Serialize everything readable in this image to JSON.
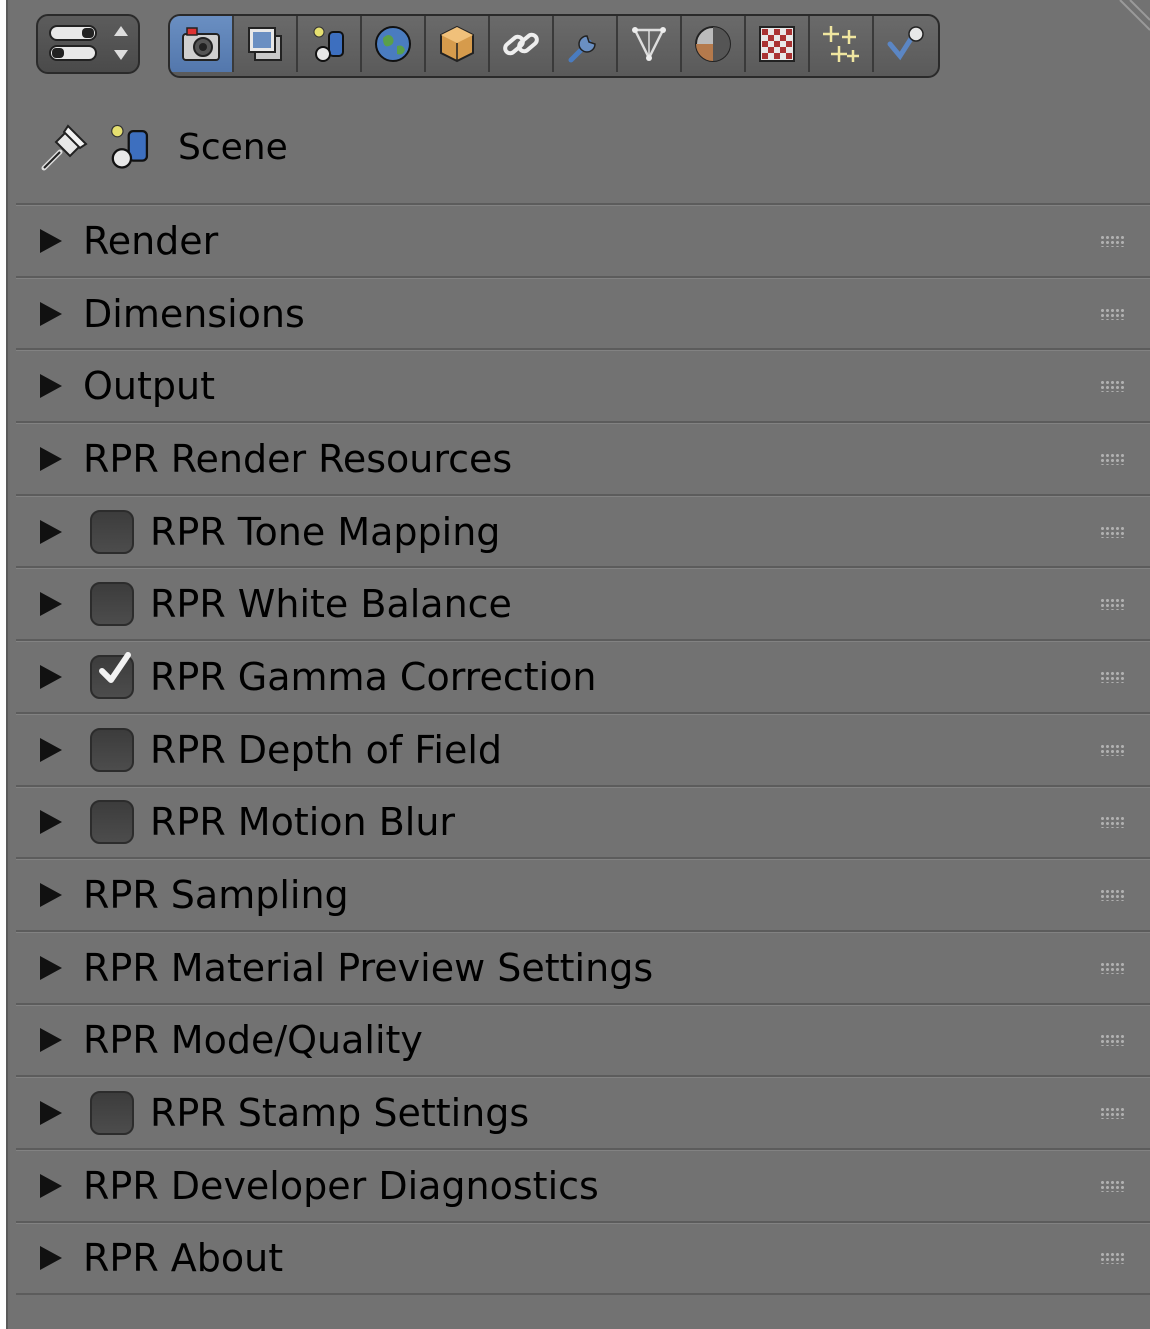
{
  "header": {
    "editor_type_icon": "properties-editor-icon",
    "tabs": [
      {
        "icon": "render-camera-icon",
        "active": true
      },
      {
        "icon": "render-layers-icon",
        "active": false
      },
      {
        "icon": "scene-icon",
        "active": false
      },
      {
        "icon": "world-icon",
        "active": false
      },
      {
        "icon": "object-icon",
        "active": false
      },
      {
        "icon": "constraints-icon",
        "active": false
      },
      {
        "icon": "modifiers-icon",
        "active": false
      },
      {
        "icon": "mesh-data-icon",
        "active": false
      },
      {
        "icon": "material-icon",
        "active": false
      },
      {
        "icon": "texture-icon",
        "active": false
      },
      {
        "icon": "particles-icon",
        "active": false
      },
      {
        "icon": "physics-icon",
        "active": false
      }
    ]
  },
  "context": {
    "pin_icon": "pin-icon",
    "scene_icon": "scene-icon",
    "label": "Scene"
  },
  "panels": [
    {
      "label": "Render",
      "has_checkbox": false,
      "checked": false
    },
    {
      "label": "Dimensions",
      "has_checkbox": false,
      "checked": false
    },
    {
      "label": "Output",
      "has_checkbox": false,
      "checked": false
    },
    {
      "label": "RPR Render Resources",
      "has_checkbox": false,
      "checked": false
    },
    {
      "label": "RPR Tone Mapping",
      "has_checkbox": true,
      "checked": false
    },
    {
      "label": "RPR White Balance",
      "has_checkbox": true,
      "checked": false
    },
    {
      "label": "RPR Gamma Correction",
      "has_checkbox": true,
      "checked": true
    },
    {
      "label": "RPR Depth of Field",
      "has_checkbox": true,
      "checked": false
    },
    {
      "label": "RPR Motion Blur",
      "has_checkbox": true,
      "checked": false
    },
    {
      "label": "RPR Sampling",
      "has_checkbox": false,
      "checked": false
    },
    {
      "label": "RPR Material Preview Settings",
      "has_checkbox": false,
      "checked": false
    },
    {
      "label": "RPR Mode/Quality",
      "has_checkbox": false,
      "checked": false
    },
    {
      "label": "RPR Stamp Settings",
      "has_checkbox": true,
      "checked": false
    },
    {
      "label": "RPR Developer Diagnostics",
      "has_checkbox": false,
      "checked": false
    },
    {
      "label": "RPR About",
      "has_checkbox": false,
      "checked": false
    }
  ],
  "colors": {
    "background": "#727272",
    "active_tab": "#5e83b8",
    "text": "#000000"
  }
}
